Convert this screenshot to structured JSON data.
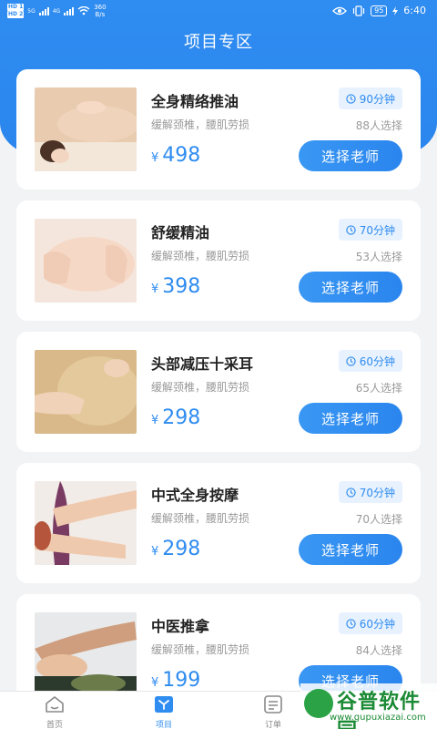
{
  "status_bar": {
    "sim1": "HD 1",
    "sim2": "HD 2",
    "net1": "5G",
    "net2": "4G",
    "speed_value": "360",
    "speed_unit": "B/s",
    "battery": "95",
    "time": "6:40"
  },
  "header": {
    "title": "项目专区"
  },
  "items": [
    {
      "name": "全身精络推油",
      "desc": "缓解颈椎，腰肌劳损",
      "currency": "¥",
      "price": "498",
      "duration": "90分钟",
      "count": "88人选择",
      "button": "选择老师",
      "thumb": "massage-back-photo"
    },
    {
      "name": "舒缓精油",
      "desc": "缓解颈椎，腰肌劳损",
      "currency": "¥",
      "price": "398",
      "duration": "70分钟",
      "count": "53人选择",
      "button": "选择老师",
      "thumb": "oil-massage-photo"
    },
    {
      "name": "头部减压十采耳",
      "desc": "缓解颈椎，腰肌劳损",
      "currency": "¥",
      "price": "298",
      "duration": "60分钟",
      "count": "65人选择",
      "button": "选择老师",
      "thumb": "head-massage-photo"
    },
    {
      "name": "中式全身按摩",
      "desc": "缓解颈椎，腰肌劳损",
      "currency": "¥",
      "price": "298",
      "duration": "70分钟",
      "count": "70人选择",
      "button": "选择老师",
      "thumb": "body-massage-photo"
    },
    {
      "name": "中医推拿",
      "desc": "缓解颈椎，腰肌劳损",
      "currency": "¥",
      "price": "199",
      "duration": "60分钟",
      "count": "84人选择",
      "button": "选择老师",
      "thumb": "tuina-photo"
    }
  ],
  "tabbar": {
    "home": {
      "label": "首页",
      "icon": "home-icon"
    },
    "projects": {
      "label": "项目",
      "icon": "projects-icon"
    },
    "orders": {
      "label": "订单",
      "icon": "orders-icon"
    }
  },
  "watermark": {
    "title": "谷普软件园",
    "url": "www.gupuxiazai.com"
  },
  "colors": {
    "accent": "#2f8cf0",
    "badge_bg": "#e8f2fe"
  }
}
